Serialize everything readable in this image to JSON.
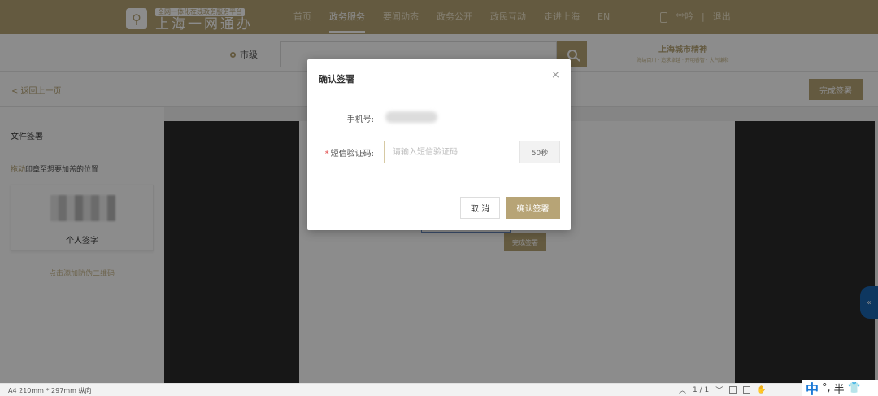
{
  "header": {
    "logo_tagline": "全网一体化在线政务服务平台",
    "logo_name": "上海一网通办",
    "nav": [
      "首页",
      "政务服务",
      "要闻动态",
      "政务公开",
      "政民互动",
      "走进上海",
      "EN"
    ],
    "user_name": "**吟",
    "separator": "|",
    "logout": "退出"
  },
  "search": {
    "region": "市级",
    "placeholder": "",
    "spirit_title": "上海城市精神",
    "spirit_sub": "海纳百川 · 追求卓越 · 开明睿智 · 大气谦和"
  },
  "actionbar": {
    "back": "< 返回上一页",
    "finish": "完成签署"
  },
  "leftpanel": {
    "title": "文件签署",
    "hint_drag": "拖动",
    "hint_rest": "印章至想要加盖的位置",
    "sign_label": "个人签字",
    "add_qr": "点击添加防伪二维码"
  },
  "document": {
    "finish_sign": "完成签署"
  },
  "bottombar": {
    "paper_info": "A4 210mm * 297mm 纵向",
    "page": "1 / 1"
  },
  "ime": {
    "lang": "中",
    "punct": "°,",
    "width": "半"
  },
  "modal": {
    "title": "确认签署",
    "close": "×",
    "phone_label": "手机号:",
    "sms_label": "短信验证码:",
    "sms_required": "*",
    "sms_placeholder": "请输入短信验证码",
    "countdown": "50秒",
    "cancel": "取 消",
    "confirm": "确认签署"
  },
  "colors": {
    "brand": "#b7a476",
    "overlay": "rgba(0,0,0,0.45)"
  }
}
